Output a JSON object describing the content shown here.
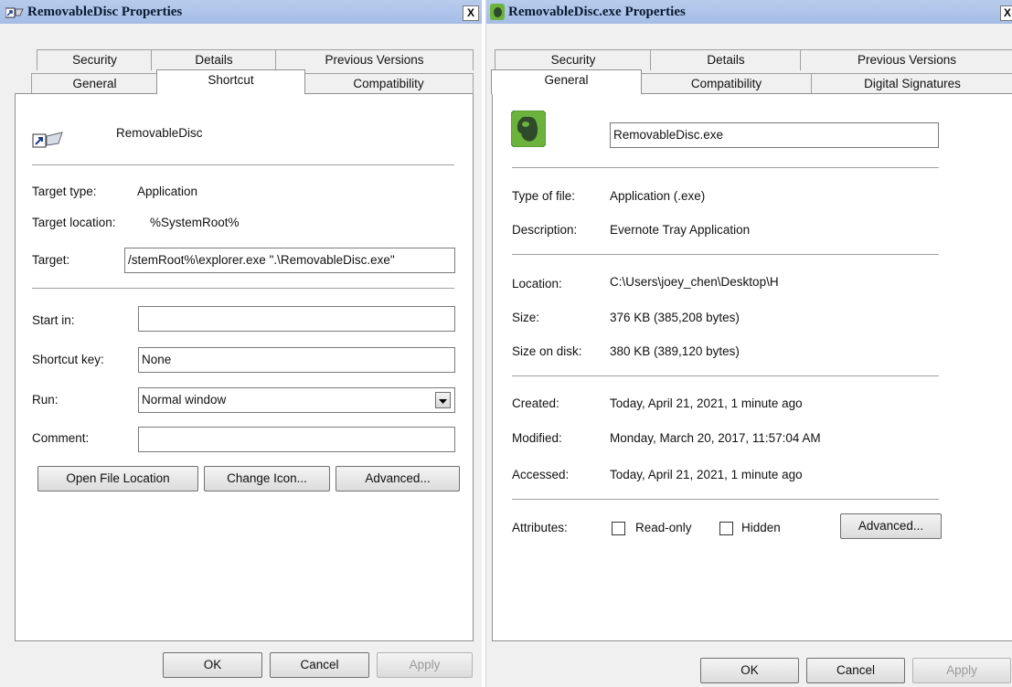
{
  "left": {
    "title": "RemovableDisc Properties",
    "close": "X",
    "tabs_top": [
      "Security",
      "Details",
      "Previous Versions"
    ],
    "tabs_bottom": [
      "General",
      "Shortcut",
      "Compatibility"
    ],
    "active_tab": "Shortcut",
    "name": "RemovableDisc",
    "target_type_label": "Target type:",
    "target_type_value": "Application",
    "target_location_label": "Target location:",
    "target_location_value": "%SystemRoot%",
    "target_label": "Target:",
    "target_value": "/stemRoot%\\explorer.exe \".\\RemovableDisc.exe\"",
    "start_in_label": "Start in:",
    "start_in_value": "",
    "shortcut_key_label": "Shortcut key:",
    "shortcut_key_value": "None",
    "run_label": "Run:",
    "run_value": "Normal window",
    "comment_label": "Comment:",
    "comment_value": "",
    "open_file_location": "Open File Location",
    "change_icon": "Change Icon...",
    "advanced": "Advanced...",
    "ok": "OK",
    "cancel": "Cancel",
    "apply": "Apply"
  },
  "right": {
    "title": "RemovableDisc.exe Properties",
    "close": "X",
    "tabs_top": [
      "Security",
      "Details",
      "Previous Versions"
    ],
    "tabs_bottom": [
      "General",
      "Compatibility",
      "Digital Signatures"
    ],
    "active_tab": "General",
    "filename": "RemovableDisc.exe",
    "type_label": "Type of file:",
    "type_value": "Application (.exe)",
    "desc_label": "Description:",
    "desc_value": "Evernote Tray Application",
    "location_label": "Location:",
    "location_value": "C:\\Users\\joey_chen\\Desktop\\H",
    "size_label": "Size:",
    "size_value": "376 KB (385,208 bytes)",
    "size_disk_label": "Size on disk:",
    "size_disk_value": "380 KB (389,120 bytes)",
    "created_label": "Created:",
    "created_value": "Today, April 21, 2021, 1 minute ago",
    "modified_label": "Modified:",
    "modified_value": "Monday, March 20, 2017, 11:57:04 AM",
    "accessed_label": "Accessed:",
    "accessed_value": "Today, April 21, 2021, 1 minute ago",
    "attributes_label": "Attributes:",
    "readonly_label": "Read-only",
    "hidden_label": "Hidden",
    "advanced": "Advanced...",
    "ok": "OK",
    "cancel": "Cancel",
    "apply": "Apply"
  },
  "colors": {
    "titlebar": "#aec4ea",
    "evernote_green": "#6cb33e"
  }
}
